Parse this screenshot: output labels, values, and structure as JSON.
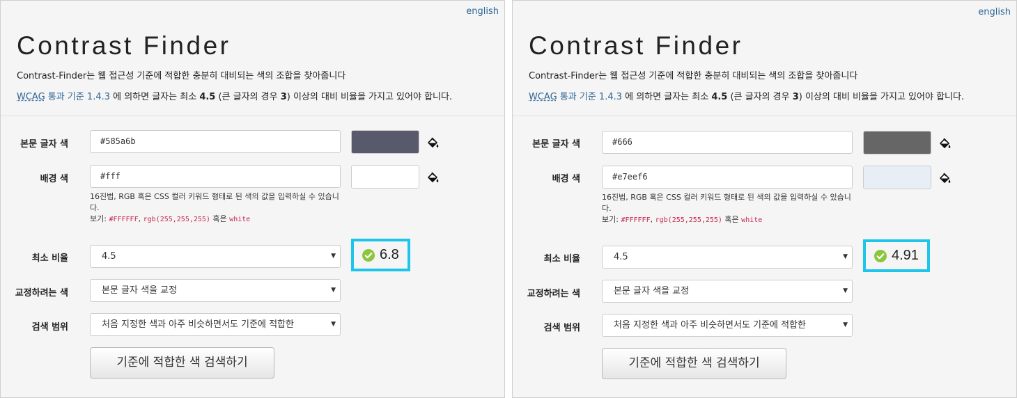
{
  "common": {
    "language_link": "english",
    "app_title": "Contrast Finder",
    "description": "Contrast-Finder는 웹 접근성 기준에 적합한 충분히 대비되는 색의 조합을 찾아줍니다",
    "wcag": {
      "abbr": "WCAG",
      "link_text": "통과 기준 1.4.3",
      "text_before_bold1": " 에 의하면 글자는 최소 ",
      "bold1": "4.5",
      "text_between": " (큰 글자의 경우 ",
      "bold2": "3",
      "text_after": ") 이상의 대비 비율을 가지고 있어야 합니다."
    },
    "labels": {
      "foreground": "본문 글자 색",
      "background": "배경 색",
      "min_ratio": "최소 비율",
      "color_to_fix": "교정하려는 색",
      "search_range": "검색 범위"
    },
    "help": {
      "line": "16진법, RGB 혹은 CSS 컬러 키워드 형태로 된 색의 값을 입력하실 수 있습니다.",
      "example_prefix": "보기: ",
      "example_hex": "#FFFFFF",
      "example_sep": ", ",
      "example_rgb": "rgb(255,255,255)",
      "example_or": " 혹은 ",
      "example_keyword": "white"
    },
    "min_ratio_selected": "4.5",
    "color_to_fix_selected": "본문 글자 색을 교정",
    "search_range_selected": "처음 지정한 색과 아주 비슷하면서도 기준에 적합한",
    "search_button": "기준에 적합한 색 검색하기",
    "icons": {
      "picker": "paint-bucket-icon",
      "check": "check-circle-icon",
      "dropdown": "caret-down-icon"
    },
    "colors": {
      "link": "#2a6496",
      "highlight_border": "#1ec5ea",
      "check_green": "#8cc63f",
      "code_text": "#c7254e"
    }
  },
  "left": {
    "foreground_value": "#585a6b",
    "foreground_swatch": "#585a6b",
    "background_value": "#fff",
    "background_swatch": "#ffffff",
    "ratio": "6.8"
  },
  "right": {
    "foreground_value": "#666",
    "foreground_swatch": "#666666",
    "background_value": "#e7eef6",
    "background_swatch": "#e7eef6",
    "ratio": "4.91"
  }
}
